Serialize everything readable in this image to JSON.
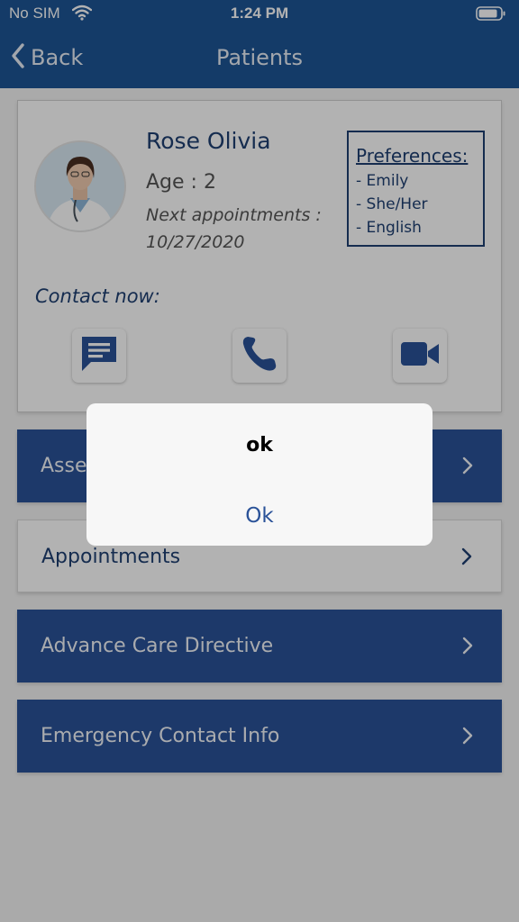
{
  "status_bar": {
    "carrier": "No SIM",
    "time": "1:24 PM",
    "icons": [
      "wifi-icon",
      "battery-icon"
    ]
  },
  "nav": {
    "back_label": "Back",
    "title": "Patients"
  },
  "patient": {
    "name": "Rose Olivia",
    "age": "Age : 2",
    "next_appointment_label": "Next appointments :",
    "next_appointment_date": "10/27/2020",
    "avatar_icon": "doctor-photo"
  },
  "preferences": {
    "title": "Preferences:",
    "items": [
      "-  Emily",
      "-  She/Her",
      "-  English"
    ]
  },
  "contact": {
    "label": "Contact now:",
    "buttons": [
      "message-icon",
      "phone-icon",
      "video-icon"
    ]
  },
  "menu": [
    {
      "label": "Assessments"
    },
    {
      "label": "Appointments"
    },
    {
      "label": "Advance Care Directive"
    },
    {
      "label": "Emergency Contact Info"
    }
  ],
  "dialog": {
    "title": "ok",
    "button": "Ok"
  },
  "colors": {
    "primary": "#1e5596",
    "menu_dark": "#2a5298",
    "text_dark": "#1f3f72"
  }
}
